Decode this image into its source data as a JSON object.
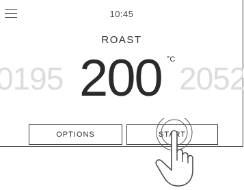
{
  "header": {
    "time": "10:45",
    "menu_icon": "hamburger-menu-icon"
  },
  "cooking": {
    "mode": "ROAST",
    "temperature_left_partial": "0195",
    "temperature": "200",
    "unit": "°C",
    "temperature_right_partial": "2052"
  },
  "buttons": {
    "options_label": "OPTIONS",
    "start_label": "START"
  },
  "overlay": {
    "tap_hand_icon": "tapping-hand-icon"
  }
}
